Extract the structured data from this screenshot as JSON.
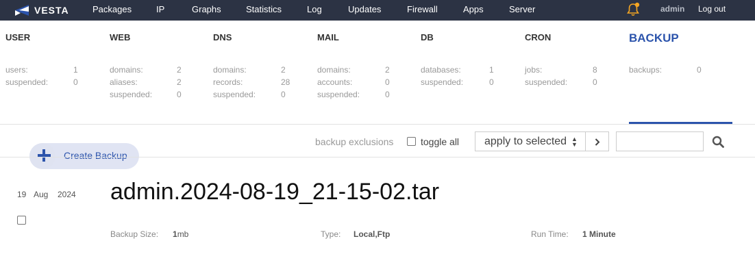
{
  "topbar": {
    "logo_text": "VESTA",
    "nav": [
      "Packages",
      "IP",
      "Graphs",
      "Statistics",
      "Log",
      "Updates",
      "Firewall",
      "Apps",
      "Server"
    ],
    "user": "admin",
    "logout": "Log out"
  },
  "stats": [
    {
      "title": "USER",
      "rows": [
        {
          "label": "users:",
          "value": "1"
        },
        {
          "label": "suspended:",
          "value": "0"
        }
      ]
    },
    {
      "title": "WEB",
      "rows": [
        {
          "label": "domains:",
          "value": "2"
        },
        {
          "label": "aliases:",
          "value": "2"
        },
        {
          "label": "suspended:",
          "value": "0"
        }
      ]
    },
    {
      "title": "DNS",
      "rows": [
        {
          "label": "domains:",
          "value": "2"
        },
        {
          "label": "records:",
          "value": "28"
        },
        {
          "label": "suspended:",
          "value": "0"
        }
      ]
    },
    {
      "title": "MAIL",
      "rows": [
        {
          "label": "domains:",
          "value": "2"
        },
        {
          "label": "accounts:",
          "value": "0"
        },
        {
          "label": "suspended:",
          "value": "0"
        }
      ]
    },
    {
      "title": "DB",
      "rows": [
        {
          "label": "databases:",
          "value": "1"
        },
        {
          "label": "suspended:",
          "value": "0"
        }
      ]
    },
    {
      "title": "CRON",
      "rows": [
        {
          "label": "jobs:",
          "value": "8"
        },
        {
          "label": "suspended:",
          "value": "0"
        }
      ]
    },
    {
      "title": "BACKUP",
      "rows": [
        {
          "label": "backups:",
          "value": "0"
        }
      ]
    }
  ],
  "toolbar": {
    "create_label": "Create Backup",
    "exclusions": "backup exclusions",
    "toggle_all": "toggle all",
    "action_selected": "apply to selected",
    "search_value": ""
  },
  "backup": {
    "day": "19",
    "month": "Aug",
    "year": "2024",
    "name": "admin.2024-08-19_21-15-02.tar",
    "size_label": "Backup Size:",
    "size_value": "1",
    "size_unit": "mb",
    "type_label": "Type:",
    "type_value": "Local,Ftp",
    "runtime_label": "Run Time:",
    "runtime_value": "1 Minute"
  },
  "colors": {
    "topbar": "#2c3344",
    "accent": "#2c54ac",
    "bell": "#f5a623"
  }
}
